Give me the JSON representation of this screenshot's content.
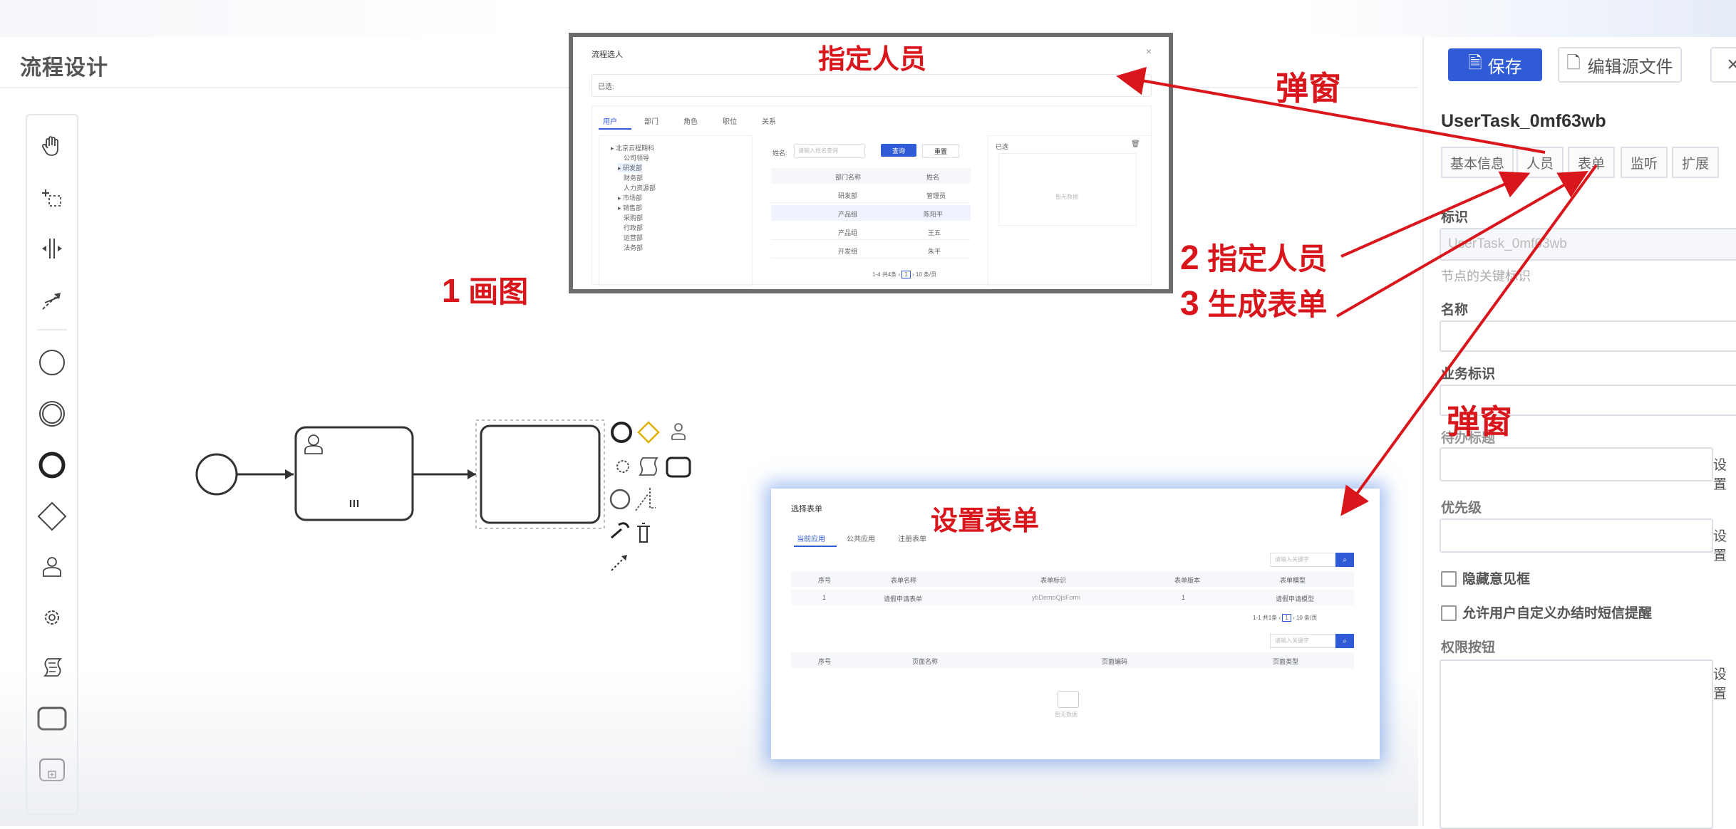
{
  "page": {
    "title": "流程设计"
  },
  "annotations": {
    "draw": "1 画图",
    "draw_num": "1",
    "draw_text": "画图",
    "assign_num": "2",
    "assign_text": "指定人员",
    "form_num": "3",
    "form_text": "生成表单",
    "popup1": "弹窗",
    "popup2": "弹窗",
    "dialog1_title": "指定人员",
    "dialog2_title": "设置表单",
    "color": "#d9161c"
  },
  "palette": {
    "icons": [
      "hand-tool-icon",
      "lasso-tool-icon",
      "space-tool-icon",
      "global-connect-icon",
      "start-event-icon",
      "intermediate-event-icon",
      "end-event-icon",
      "gateway-icon",
      "user-task-icon",
      "service-task-icon",
      "script-task-icon",
      "task-icon",
      "subprocess-icon"
    ]
  },
  "dialog_users": {
    "title": "流程选人",
    "selected_label": "已选:",
    "tabs": [
      "用户",
      "部门",
      "角色",
      "职位",
      "关系"
    ],
    "tree": [
      "北京云程期科",
      "公司领导",
      "研发部",
      "财务部",
      "人力资源部",
      "市场部",
      "销售部",
      "采购部",
      "行政部",
      "运营部",
      "法务部"
    ],
    "search_label": "姓名:",
    "search_placeholder": "请输入姓名查询",
    "search_button": "查询",
    "reset_button": "重置",
    "columns": [
      "部门名称",
      "姓名"
    ],
    "rows": [
      [
        "研发部",
        "管理员"
      ],
      [
        "产品组",
        "陈阳平"
      ],
      [
        "产品组",
        "王五"
      ],
      [
        "开发组",
        "朱平"
      ]
    ],
    "pagination": "1-4 共4条",
    "page_num": "1",
    "page_size": "10 条/页",
    "selected_title": "已选",
    "empty_text": "暂无数据"
  },
  "dialog_form": {
    "title": "选择表单",
    "tabs": [
      "当前应用",
      "公共应用",
      "注册表单"
    ],
    "search_placeholder": "请输入关键字",
    "columns": [
      "序号",
      "表单名称",
      "表单标识",
      "表单版本",
      "表单模型"
    ],
    "row": [
      "1",
      "请假申请表单",
      "ybDemoQjsForm",
      "1",
      "请假申请模型"
    ],
    "pagination": "1-1 共1条",
    "page_num": "1",
    "page_size": "10 条/页",
    "search_placeholder2": "请输入关键字",
    "columns2": [
      "序号",
      "页面名称",
      "页面编码",
      "页面类型"
    ],
    "empty_text": "暂无数据"
  },
  "toolbar": {
    "save": "保存",
    "edit_source": "编辑源文件",
    "close": "×"
  },
  "properties": {
    "node_id": "UserTask_0mf63wb",
    "tabs": [
      "基本信息",
      "人员",
      "表单",
      "监听",
      "扩展"
    ],
    "id_label": "标识",
    "id_value": "UserTask_0mf63wb",
    "id_hint": "节点的关键标识",
    "name_label": "名称",
    "business_label": "业务标识",
    "todo_label": "待办标题",
    "set_button": "设置",
    "priority_label": "优先级",
    "hide_opinion": "隐藏意见框",
    "custom_sms": "允许用户自定义办结时短信提醒",
    "permission_label": "权限按钮"
  }
}
